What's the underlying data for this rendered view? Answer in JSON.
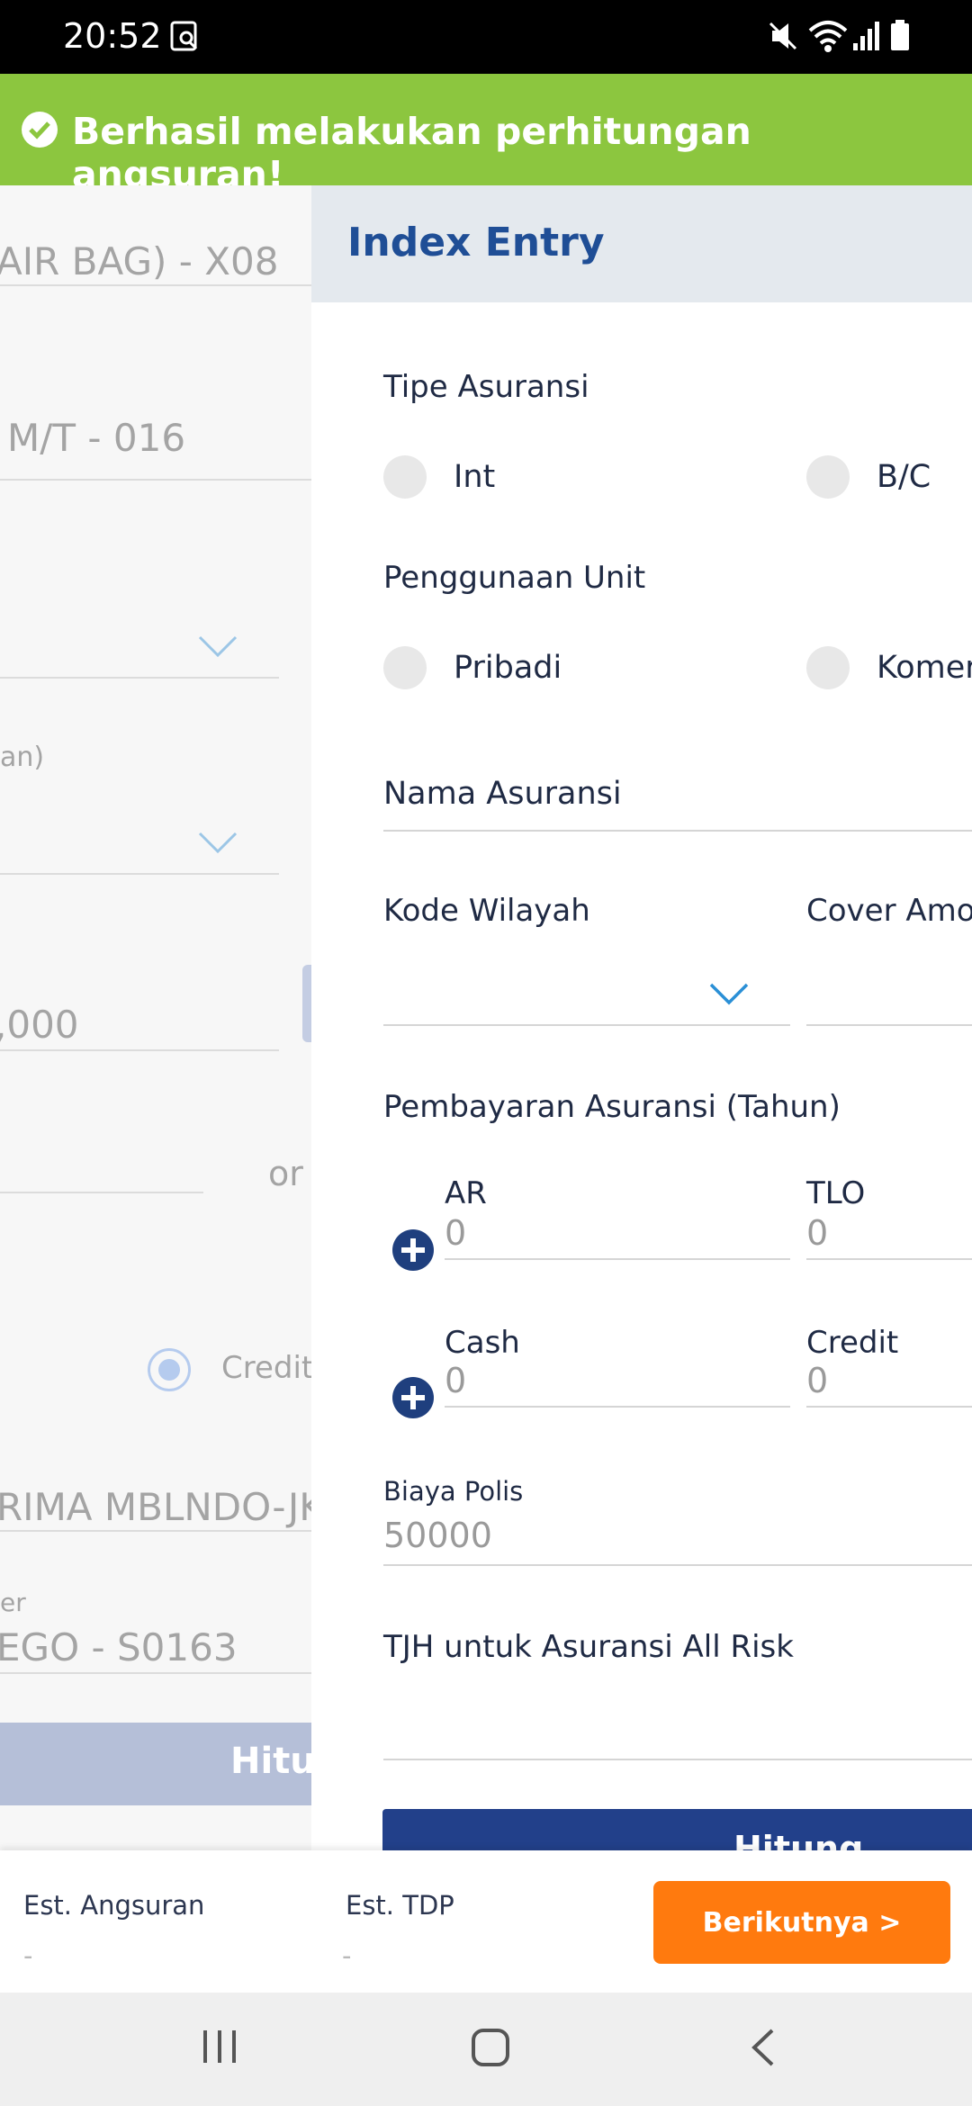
{
  "status_bar": {
    "time": "20:52"
  },
  "toast": {
    "message": "Berhasil melakukan perhitungan angsuran!"
  },
  "background_form": {
    "field1_value": "AIR BAG) - X08",
    "field2_value": "M/T - 016",
    "field3_label": "an)",
    "field4_value": ",000",
    "or_text": "or",
    "credit_label": "Credit",
    "field5_value": "RIMA MBLNDO-JK",
    "field6_label": "er",
    "field6_value": "EGO - S0163",
    "hitung_label": "Hitur"
  },
  "drawer": {
    "title": "Index Entry",
    "tipe_asuransi": {
      "label": "Tipe Asuransi",
      "options": [
        "Int",
        "B/C"
      ]
    },
    "penggunaan_unit": {
      "label": "Penggunaan Unit",
      "options": [
        "Pribadi",
        "Komer"
      ]
    },
    "nama_asuransi": {
      "placeholder": "Nama Asuransi"
    },
    "kode_wilayah": {
      "label": "Kode Wilayah"
    },
    "cover_amount": {
      "label": "Cover Amo"
    },
    "pembayaran": {
      "label": "Pembayaran Asuransi (Tahun)",
      "ar": {
        "label": "AR",
        "value": "0"
      },
      "tlo": {
        "label": "TLO",
        "value": "0"
      },
      "cash": {
        "label": "Cash",
        "value": "0"
      },
      "credit": {
        "label": "Credit",
        "value": "0"
      }
    },
    "biaya_polis": {
      "label": "Biaya Polis",
      "value": "50000"
    },
    "tjh": {
      "label": "TJH untuk Asuransi All Risk"
    },
    "hitung_button": "Hitung"
  },
  "bottom_bar": {
    "est_angsuran_label": "Est. Angsuran",
    "est_angsuran_value": "-",
    "est_tdp_label": "Est. TDP",
    "est_tdp_value": "-",
    "next_button": "Berikutnya >"
  },
  "colors": {
    "toast_green": "#8cc63f",
    "brand_blue": "#1f4e96",
    "button_blue": "#22408a",
    "accent_orange": "#ff7a0e"
  }
}
